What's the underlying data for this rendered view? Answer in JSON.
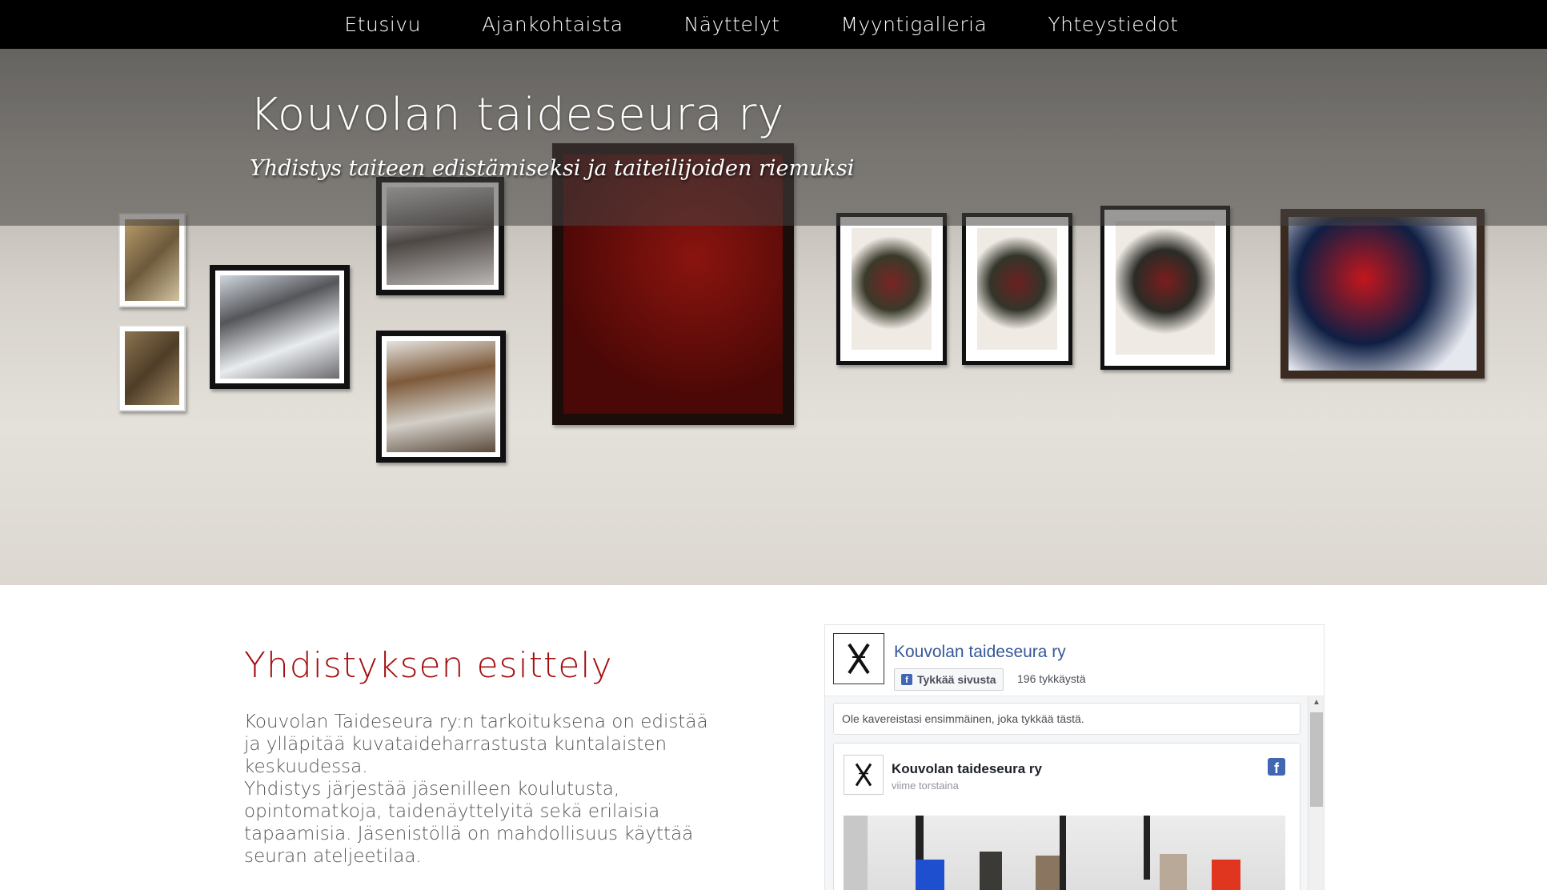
{
  "nav": {
    "items": [
      {
        "label": "Etusivu"
      },
      {
        "label": "Ajankohtaista"
      },
      {
        "label": "Näyttelyt"
      },
      {
        "label": "Myyntigalleria"
      },
      {
        "label": "Yhteystiedot"
      }
    ]
  },
  "hero": {
    "title": "Kouvolan taideseura ry",
    "subtitle": "Yhdistys taiteen edistämiseksi ja taiteilijoiden riemuksi"
  },
  "intro": {
    "title": "Yhdistyksen esittely",
    "lines": [
      "Kouvolan Taideseura ry:n tarkoituksena on edistää",
      "ja ylläpitää kuvataideharrastusta kuntalaisten",
      "keskuudessa.",
      "Yhdistys järjestää jäsenilleen koulutusta,",
      "opintomatkoja, taidenäyttelyitä sekä erilaisia",
      "tapaamisia. Jäsenistöllä on mahdollisuus käyttää",
      "seuran ateljeetilaa."
    ]
  },
  "facebook": {
    "page_name": "Kouvolan taideseura ry",
    "like_button": "Tykkää sivusta",
    "like_count": "196 tykkäystä",
    "friends_prompt": "Ole kavereistasi ensimmäinen, joka tykkää tästä.",
    "post": {
      "author": "Kouvolan taideseura ry",
      "time": "viime torstaina"
    }
  },
  "colors": {
    "nav_bg": "#000000",
    "accent_red": "#a40f0f",
    "fb_blue": "#4267b2",
    "fb_link": "#365899"
  },
  "icons": {
    "facebook": "facebook-icon",
    "logo": "x-logo-icon"
  }
}
